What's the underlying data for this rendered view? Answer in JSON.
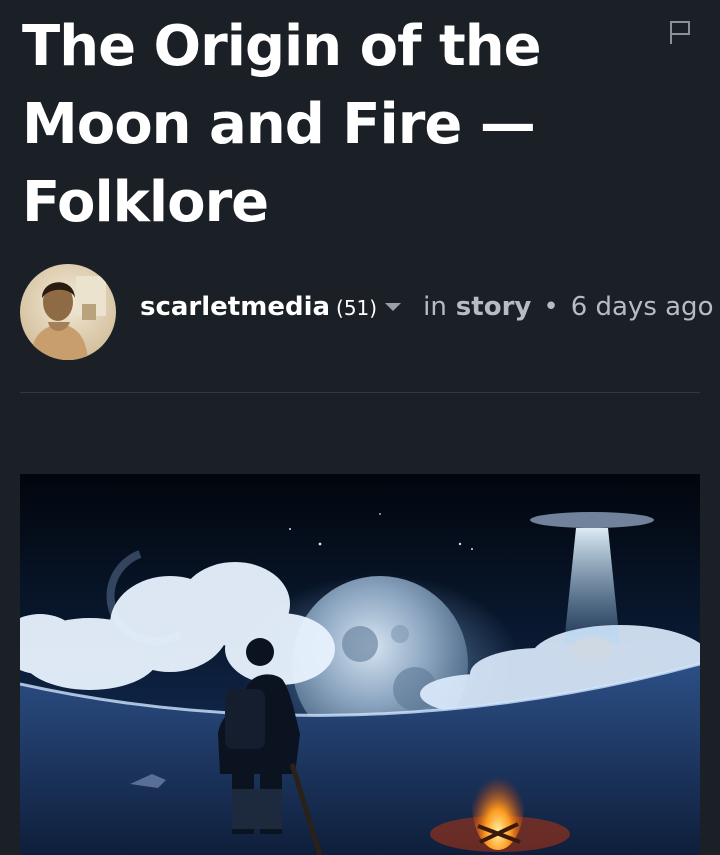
{
  "post": {
    "title": "The Origin of the Moon and Fire — Folklore",
    "author": {
      "name": "scarletmedia",
      "reputation": "(51)"
    },
    "in_label": "in",
    "category": "story",
    "separator": "•",
    "posted_ago": "6 days ago"
  },
  "icons": {
    "flag": "flag-icon",
    "dropdown": "caret-down-icon"
  },
  "colors": {
    "background": "#1b2026",
    "title": "#ffffff",
    "meta": "#b7bcc3",
    "divider": "#2d3a46"
  }
}
